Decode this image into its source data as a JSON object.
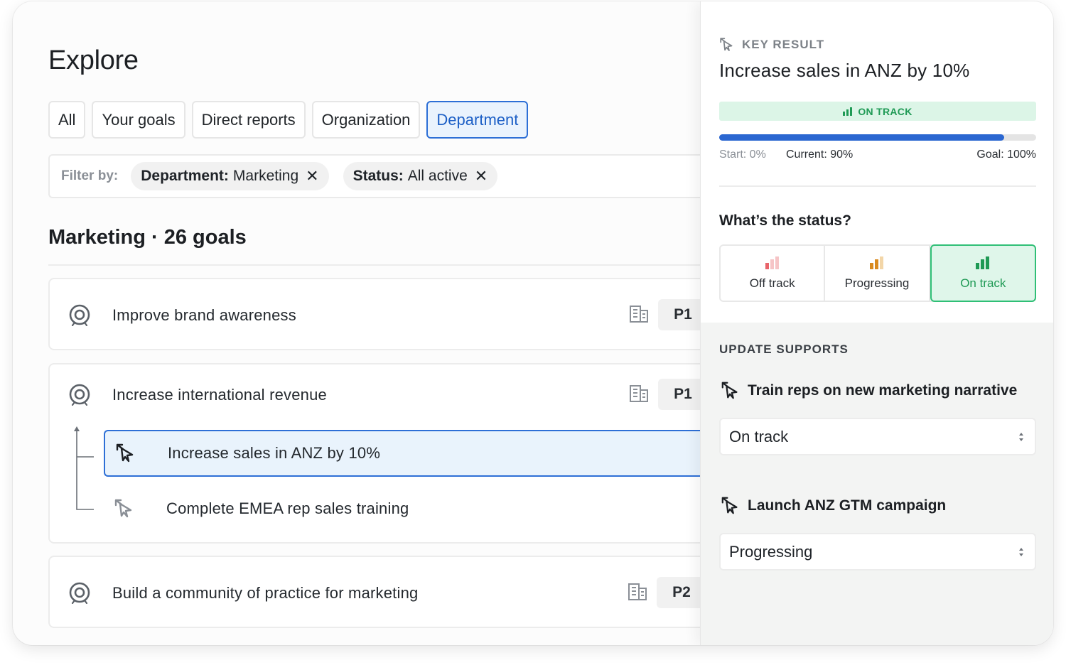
{
  "page": {
    "title": "Explore"
  },
  "tabs": [
    {
      "label": "All",
      "active": false
    },
    {
      "label": "Your goals",
      "active": false
    },
    {
      "label": "Direct reports",
      "active": false
    },
    {
      "label": "Organization",
      "active": false
    },
    {
      "label": "Department",
      "active": true
    }
  ],
  "filter": {
    "label": "Filter by:",
    "chips": [
      {
        "key": "Department:",
        "value": "Marketing"
      },
      {
        "key": "Status:",
        "value": "All active"
      }
    ]
  },
  "section": {
    "title": "Marketing · 26 goals"
  },
  "goals": [
    {
      "title": "Improve brand awareness",
      "priority": "P1"
    },
    {
      "title": "Increase international revenue",
      "priority": "P1",
      "key_results": [
        {
          "title": "Increase sales in ANZ by 10%",
          "selected": true
        },
        {
          "title": "Complete EMEA rep sales training",
          "selected": false
        }
      ]
    },
    {
      "title": "Build a community of practice for marketing",
      "priority": "P2"
    }
  ],
  "panel": {
    "eyebrow": "KEY RESULT",
    "title": "Increase sales in ANZ by 10%",
    "status_banner": "ON TRACK",
    "progress": {
      "start": "Start: 0%",
      "current": "Current: 90%",
      "goal": "Goal: 100%",
      "value": 0.9
    },
    "question": "What’s the status?",
    "status_options": [
      {
        "label": "Off track",
        "selected": false
      },
      {
        "label": "Progressing",
        "selected": false
      },
      {
        "label": "On track",
        "selected": true
      }
    ],
    "update_supports_title": "UPDATE SUPPORTS",
    "supports": [
      {
        "title": "Train reps on new marketing narrative",
        "value": "On track"
      },
      {
        "title": "Launch ANZ GTM campaign",
        "value": "Progressing"
      }
    ]
  },
  "colors": {
    "accent": "#2d6fd6",
    "on_track": "#2fbf76",
    "progressing": "#d98a1f",
    "off_track": "#e8646a"
  }
}
